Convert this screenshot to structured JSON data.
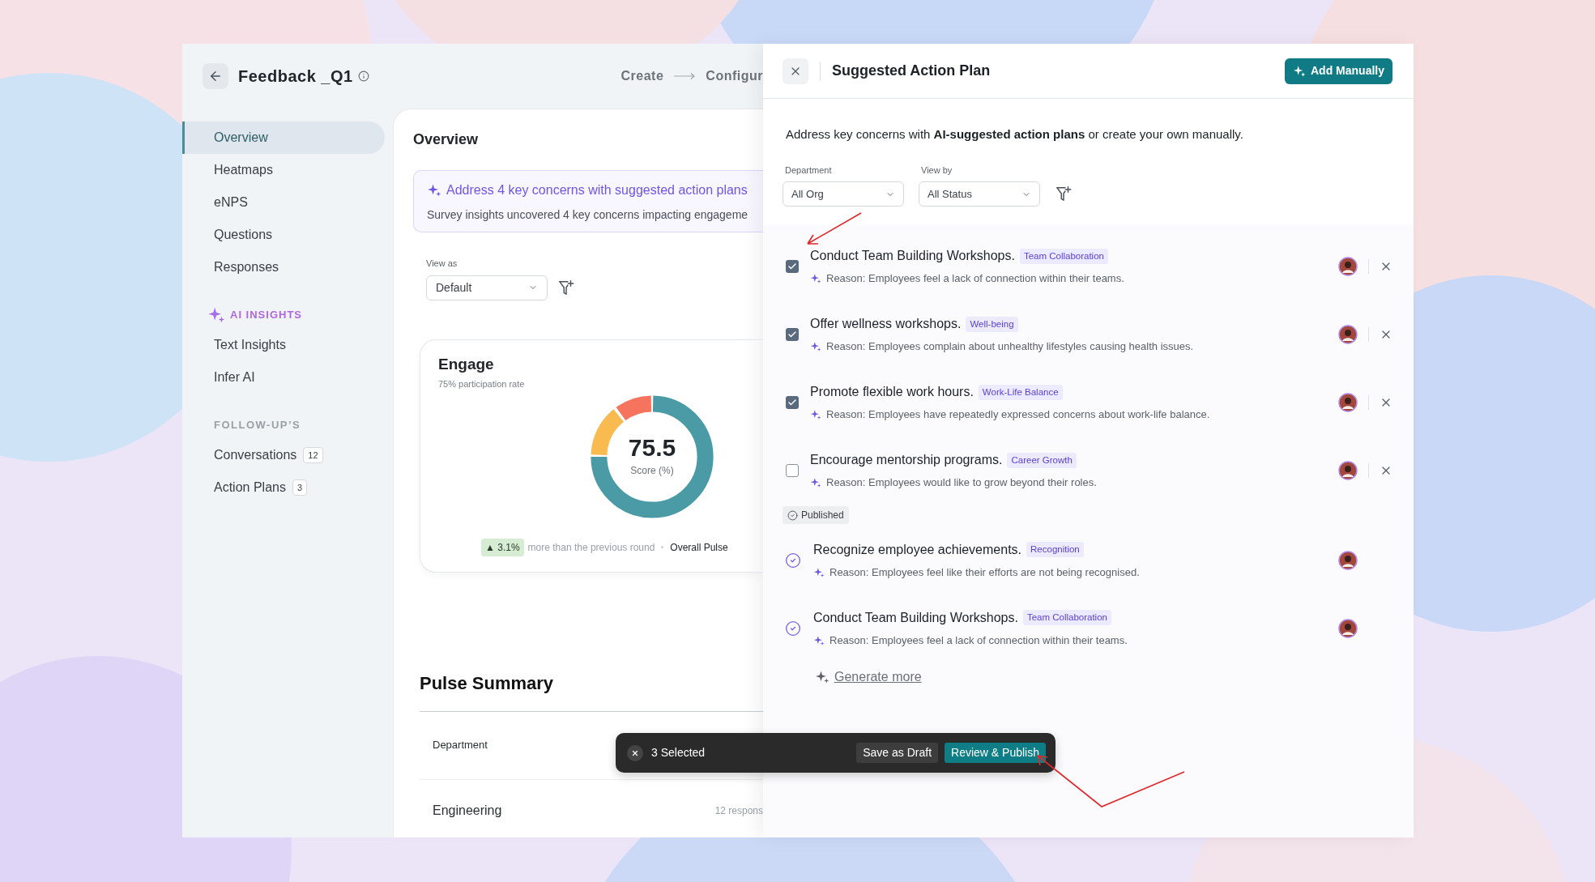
{
  "header": {
    "title": "Feedback _Q1",
    "steps": [
      "Create",
      "Configur"
    ]
  },
  "sidebar": {
    "groups": [
      {
        "kind": "main",
        "items": [
          {
            "label": "Overview",
            "selected": true
          },
          {
            "label": "Heatmaps",
            "selected": false
          },
          {
            "label": "eNPS",
            "selected": false
          },
          {
            "label": "Questions",
            "selected": false
          },
          {
            "label": "Responses",
            "selected": false
          }
        ]
      },
      {
        "kind": "ai",
        "heading": "AI INSIGHTS",
        "items": [
          {
            "label": "Text Insights",
            "selected": false
          },
          {
            "label": "Infer AI",
            "selected": false
          }
        ]
      },
      {
        "kind": "plain",
        "heading": "FOLLOW-UP’S",
        "items": [
          {
            "label": "Conversations",
            "selected": false,
            "badge": "12"
          },
          {
            "label": "Action Plans",
            "selected": false,
            "badge": "3"
          }
        ]
      }
    ]
  },
  "overview": {
    "title": "Overview",
    "alert": {
      "title": "Address 4 key concerns with suggested action plans",
      "text": "Survey insights uncovered 4 key concerns impacting engageme"
    },
    "view_as": {
      "label": "View as",
      "value": "Default"
    },
    "engage": {
      "title": "Engage",
      "subtitle": "75% participation rate",
      "score": "75.5",
      "score_label": "Score (%)",
      "delta": "▲ 3.1%",
      "comparison": "more than the previous round",
      "overall": "Overall Pulse"
    }
  },
  "pulse_summary": {
    "title": "Pulse Summary",
    "columns": [
      "Department"
    ],
    "rows": [
      {
        "cells": [
          "Engineering",
          "12 respons"
        ]
      }
    ]
  },
  "panel": {
    "title": "Suggested Action Plan",
    "add_button": "Add Manually",
    "intro": "Address key concerns with **AI-suggested action plans** or create your own manually.",
    "filters": [
      {
        "label": "Department",
        "value": "All Org"
      },
      {
        "label": "View by",
        "value": "All Status"
      }
    ],
    "suggested": [
      {
        "title": "Conduct Team Building Workshops.",
        "tag": "Team Collaboration",
        "reason": "Reason: Employees feel a lack of connection within their teams.",
        "checked": true
      },
      {
        "title": "Offer wellness workshops.",
        "tag": "Well-being",
        "reason": "Reason: Employees complain about unhealthy lifestyles causing health issues.",
        "checked": true
      },
      {
        "title": "Promote flexible work hours.",
        "tag": "Work-Life Balance",
        "reason": "Reason: Employees have repeatedly expressed concerns about work-life balance.",
        "checked": true
      },
      {
        "title": "Encourage mentorship programs.",
        "tag": "Career Growth",
        "reason": "Reason: Employees would like to grow beyond their roles.",
        "checked": false
      }
    ],
    "published_label": "Published",
    "published": [
      {
        "title": "Recognize employee achievements.",
        "tag": "Recognition",
        "reason": "Reason: Employees feel like their efforts are not being recognised."
      },
      {
        "title": "Conduct Team Building Workshops.",
        "tag": "Team Collaboration",
        "reason": "Reason: Employees feel a lack of connection within their teams."
      }
    ],
    "generate": "Generate more"
  },
  "bulk_bar": {
    "count": "3 Selected",
    "buttons": [
      {
        "label": "Save as Draft",
        "kind": "secondary"
      },
      {
        "label": "Review & Publish",
        "kind": "primary"
      }
    ]
  }
}
